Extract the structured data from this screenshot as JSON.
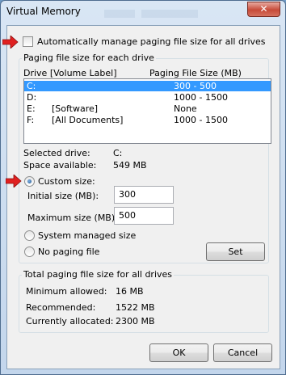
{
  "window": {
    "title": "Virtual Memory",
    "close_glyph": "✕"
  },
  "auto_manage": {
    "label": "Automatically manage paging file size for all drives",
    "checked": false
  },
  "paging_group": {
    "title": "Paging file size for each drive",
    "col_drive": "Drive  [Volume Label]",
    "col_size": "Paging File Size (MB)",
    "drives": [
      {
        "drive": "C:",
        "label": "",
        "size": "300 - 500",
        "selected": true
      },
      {
        "drive": "D:",
        "label": "",
        "size": "1000 - 1500",
        "selected": false
      },
      {
        "drive": "E:",
        "label": "[Software]",
        "size": "None",
        "selected": false
      },
      {
        "drive": "F:",
        "label": "[All Documents]",
        "size": "1000 - 1500",
        "selected": false
      }
    ],
    "selected_drive_label": "Selected drive:",
    "selected_drive_value": "C:",
    "space_available_label": "Space available:",
    "space_available_value": "549 MB",
    "custom_size_label": "Custom size:",
    "initial_size_label": "Initial size (MB):",
    "initial_size_value": "300",
    "maximum_size_label": "Maximum size (MB):",
    "maximum_size_value": "500",
    "system_managed_label": "System managed size",
    "no_paging_label": "No paging file",
    "selected_option": "custom",
    "set_button": "Set"
  },
  "totals_group": {
    "title": "Total paging file size for all drives",
    "minimum_label": "Minimum allowed:",
    "minimum_value": "16 MB",
    "recommended_label": "Recommended:",
    "recommended_value": "1522 MB",
    "allocated_label": "Currently allocated:",
    "allocated_value": "2300 MB"
  },
  "buttons": {
    "ok": "OK",
    "cancel": "Cancel"
  },
  "colors": {
    "selection": "#3399ff",
    "annotation_arrow": "#e02020"
  }
}
